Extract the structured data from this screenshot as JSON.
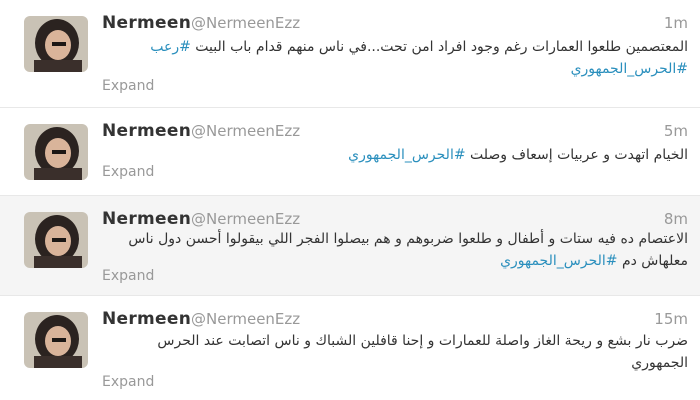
{
  "tweets": [
    {
      "name": "Nermeen",
      "handle": "@NermeenEzz",
      "time": "1m",
      "text_before": "المعتصمين طلعوا العمارات رغم وجود افراد امن تحت...في ناس منهم قدام باب البيت ",
      "tags": [
        "#رعب",
        "#الحرس_الجمهوري"
      ],
      "expand": "Expand"
    },
    {
      "name": "Nermeen",
      "handle": "@NermeenEzz",
      "time": "5m",
      "text_before": "الخيام اتهدت و عربيات إسعاف وصلت ",
      "tags": [
        "#الحرس_الجمهوري"
      ],
      "expand": "Expand"
    },
    {
      "name": "Nermeen",
      "handle": "@NermeenEzz",
      "time": "8m",
      "text_before": "الاعتصام ده فيه ستات و أطفال و طلعوا ضربوهم و هم بيصلوا الفجر اللي بيقولوا أحسن دول ناس معلهاش دم ",
      "tags": [
        "#الحرس_الجمهوري"
      ],
      "expand": "Expand"
    },
    {
      "name": "Nermeen",
      "handle": "@NermeenEzz",
      "time": "15m",
      "text_before": "ضرب نار بشع و ريحة الغاز واصلة للعمارات و إحنا قافلين الشباك و ناس اتصابت عند الحرس الجمهوري",
      "tags": [],
      "expand": "Expand"
    }
  ],
  "colors": {
    "link": "#2a8fbd",
    "name": "#333333",
    "meta": "#999999"
  }
}
